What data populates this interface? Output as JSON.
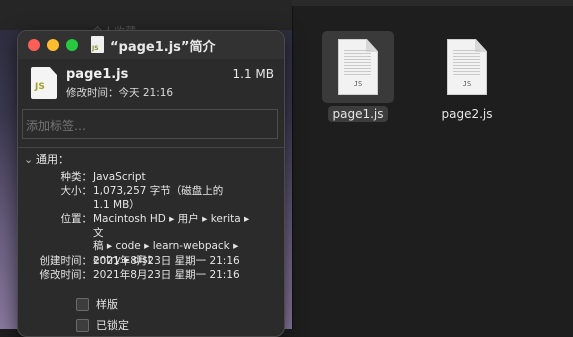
{
  "background": {
    "ghost_label": "个人收藏"
  },
  "finder": {
    "files": [
      {
        "name": "page1.js",
        "ext": "JS",
        "selected": true
      },
      {
        "name": "page2.js",
        "ext": "JS",
        "selected": false
      }
    ]
  },
  "info_window": {
    "title": "“page1.js”简介",
    "title_icon_ext": "JS",
    "header": {
      "file_name": "page1.js",
      "size": "1.1 MB",
      "modified_label": "修改时间：",
      "modified_value": "今天 21:16",
      "icon_ext": "JS"
    },
    "tags": {
      "placeholder": "添加标签…"
    },
    "general": {
      "section_label": "通用：",
      "kind_label": "种类：",
      "kind_value": "JavaScript",
      "size_label": "大小：",
      "size_value_line1": "1,073,257 字节（磁盘上的",
      "size_value_line2": "1.1 MB）",
      "where_label": "位置：",
      "where_line1": "Macintosh HD ▸ 用户 ▸ kerita ▸ 文",
      "where_line2": "稿 ▸ code ▸ learn-webpack ▸",
      "where_line3": "entry ▸ dist",
      "created_label": "创建时间：",
      "created_value": "2021年8月23日 星期一 21:16",
      "modified_label": "修改时间：",
      "modified_value": "2021年8月23日 星期一 21:16",
      "stationery_label": "样版",
      "locked_label": "已锁定"
    }
  },
  "colors": {
    "close": "#ff5f57",
    "minimize": "#febc2e",
    "zoom": "#28c840"
  }
}
